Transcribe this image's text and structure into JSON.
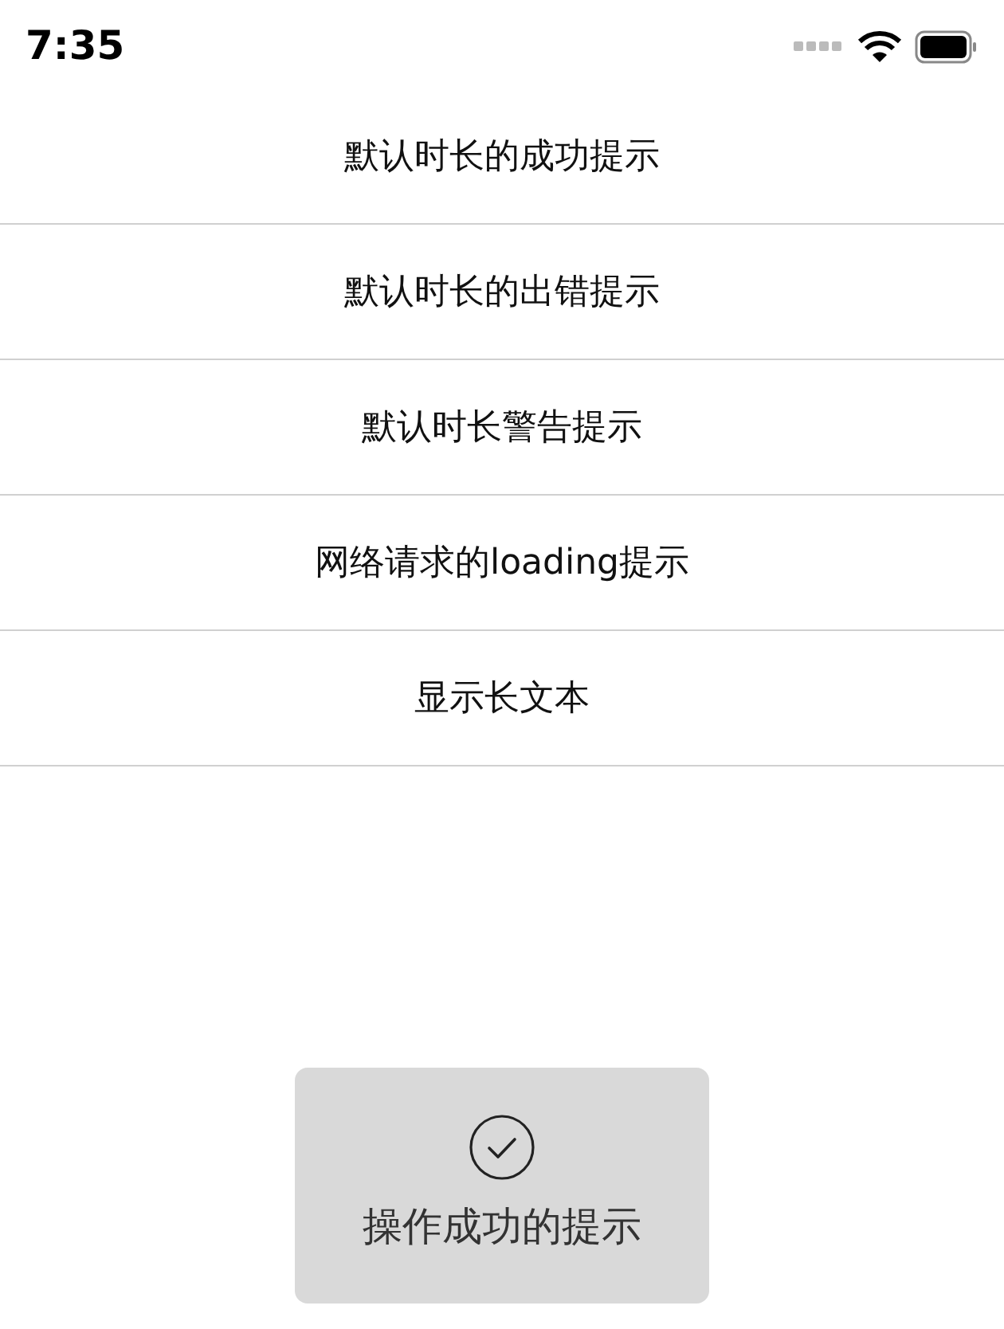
{
  "status_bar": {
    "time": "7:35"
  },
  "menu": {
    "items": [
      {
        "label": "默认时长的成功提示"
      },
      {
        "label": "默认时长的出错提示"
      },
      {
        "label": "默认时长警告提示"
      },
      {
        "label": "网络请求的loading提示"
      },
      {
        "label": "显示长文本"
      }
    ]
  },
  "toast": {
    "kind": "success",
    "message": "操作成功的提示"
  }
}
